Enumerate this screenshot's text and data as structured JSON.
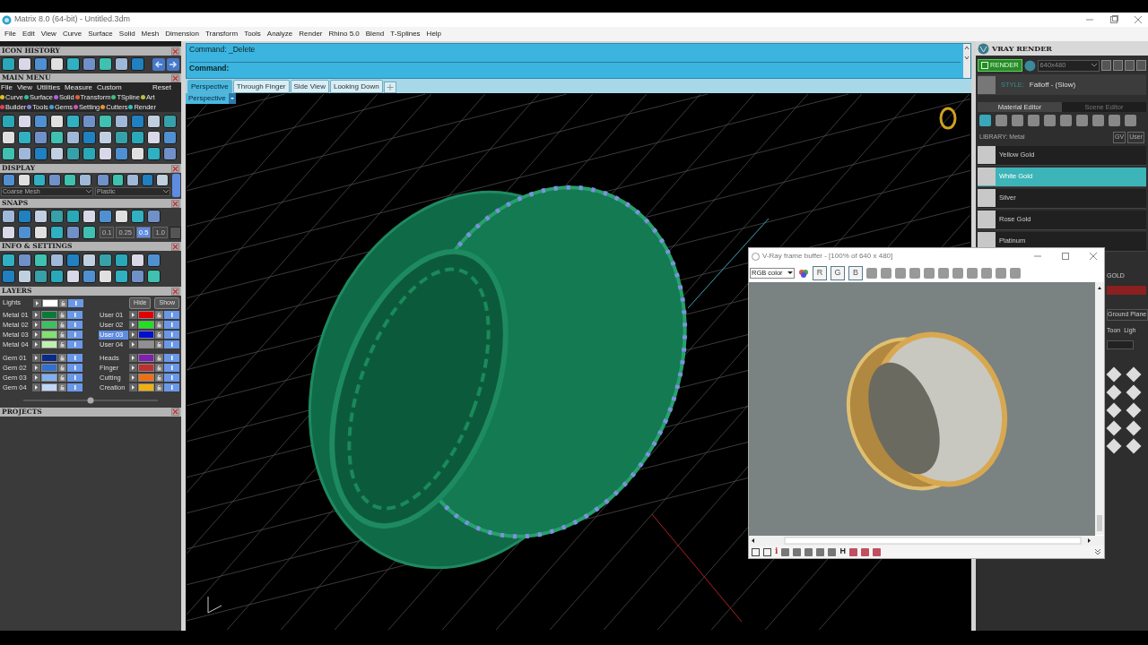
{
  "window": {
    "title": "Matrix 8.0 (64-bit) - Untitled.3dm"
  },
  "menu_bar": [
    "File",
    "Edit",
    "View",
    "Curve",
    "Surface",
    "Solid",
    "Mesh",
    "Dimension",
    "Transform",
    "Tools",
    "Analyze",
    "Render",
    "Rhino 5.0",
    "Blend",
    "T-Splines",
    "Help"
  ],
  "icon_history": {
    "title": "ICON HISTORY"
  },
  "main_menu": {
    "title": "MAIN MENU",
    "menu": [
      "File",
      "View",
      "Utilities",
      "Measure",
      "Custom"
    ],
    "reset": "Reset",
    "categories": [
      {
        "label": "Curve",
        "color": "#e0c020"
      },
      {
        "label": "Surface",
        "color": "#30c0a0"
      },
      {
        "label": "Solid",
        "color": "#b060e0"
      },
      {
        "label": "Transform",
        "color": "#e06040"
      },
      {
        "label": "TSpline",
        "color": "#40c080"
      },
      {
        "label": "Art",
        "color": "#c0c040"
      },
      {
        "label": "Builder",
        "color": "#e04060"
      },
      {
        "label": "Tools",
        "color": "#8080e0"
      },
      {
        "label": "Gems",
        "color": "#40a0e0"
      },
      {
        "label": "Setting",
        "color": "#d050c0"
      },
      {
        "label": "Cutters",
        "color": "#f09030"
      },
      {
        "label": "Render",
        "color": "#30c0c0"
      }
    ]
  },
  "display": {
    "title": "DISPLAY",
    "mesh": "Coarse Mesh",
    "material": "Plastic"
  },
  "snaps": {
    "title": "SNAPS",
    "increments": [
      {
        "label": "0.1",
        "selected": false
      },
      {
        "label": "0.25",
        "selected": false
      },
      {
        "label": "0.5",
        "selected": true
      },
      {
        "label": "1.0",
        "selected": false
      }
    ]
  },
  "info_settings": {
    "title": "INFO & SETTINGS"
  },
  "layers": {
    "title": "LAYERS",
    "lights": {
      "name": "Lights",
      "color": "#ffffff"
    },
    "hide": "Hide",
    "show": "Show",
    "left": [
      {
        "name": "Metal 01",
        "color": "#0a7a3a",
        "selected": false
      },
      {
        "name": "Metal 02",
        "color": "#3cc060",
        "selected": false
      },
      {
        "name": "Metal 03",
        "color": "#80e070",
        "selected": false
      },
      {
        "name": "Metal 04",
        "color": "#c0f0b0",
        "selected": false
      },
      {
        "name": "Gem 01",
        "color": "#0a2a8a",
        "selected": false
      },
      {
        "name": "Gem 02",
        "color": "#3070d0",
        "selected": false
      },
      {
        "name": "Gem 03",
        "color": "#80b0f0",
        "selected": false
      },
      {
        "name": "Gem 04",
        "color": "#c0d8f8",
        "selected": false
      }
    ],
    "right": [
      {
        "name": "User 01",
        "color": "#e00000",
        "selected": false
      },
      {
        "name": "User 02",
        "color": "#20e020",
        "selected": false
      },
      {
        "name": "User 03",
        "color": "#0010d0",
        "selected": true
      },
      {
        "name": "User 04",
        "color": "#909090",
        "selected": false
      },
      {
        "name": "Heads",
        "color": "#8020b0",
        "selected": false
      },
      {
        "name": "Finger",
        "color": "#c03030",
        "selected": false
      },
      {
        "name": "Cutting",
        "color": "#f07010",
        "selected": false
      },
      {
        "name": "Creation",
        "color": "#f0b010",
        "selected": false
      }
    ]
  },
  "projects": {
    "title": "PROJECTS"
  },
  "command": {
    "history": "Command: _Delete",
    "prompt": "Command:"
  },
  "viewport_tabs": [
    {
      "label": "Perspective",
      "selected": true
    },
    {
      "label": "Through Finger",
      "selected": false
    },
    {
      "label": "Side View",
      "selected": false
    },
    {
      "label": "Looking Down",
      "selected": false
    }
  ],
  "viewport": {
    "label": "Perspective"
  },
  "vray": {
    "title": "VRAY RENDER",
    "render": "RENDER",
    "resolution": "640x480",
    "style_label": "STYLE:",
    "style": "Falloff - (Slow)",
    "tabs": [
      {
        "label": "Material Editor",
        "selected": true
      },
      {
        "label": "Scene Editor",
        "selected": false
      }
    ],
    "library": "LIBRARY: Metal",
    "gv": "GV",
    "user": "User",
    "materials": [
      {
        "name": "Yellow Gold",
        "selected": false
      },
      {
        "name": "White Gold",
        "selected": true
      },
      {
        "name": "Silver",
        "selected": false
      },
      {
        "name": "Rose Gold",
        "selected": false
      },
      {
        "name": "Platinum",
        "selected": false
      }
    ],
    "partial": {
      "heading": "GOLD",
      "ground": "Ground Plane",
      "toon": "Toon",
      "light": "Ligh"
    }
  },
  "frame_buffer": {
    "title": "V-Ray frame buffer - [100% of 640 x 480]",
    "channel": "RGB color",
    "channels": [
      "R",
      "G",
      "B"
    ],
    "glyphs": [
      "i",
      "H"
    ]
  }
}
